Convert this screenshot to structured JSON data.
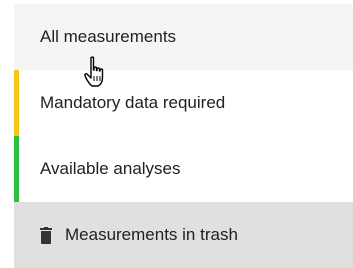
{
  "menu": {
    "items": [
      {
        "label": "All measurements",
        "accent": null
      },
      {
        "label": "Mandatory data required",
        "accent": "#f5c518"
      },
      {
        "label": "Available analyses",
        "accent": "#2dbf3f"
      },
      {
        "label": "Measurements in trash",
        "icon": "trash-icon"
      }
    ]
  },
  "pointer": {
    "icon": "hand-pointer-icon"
  }
}
